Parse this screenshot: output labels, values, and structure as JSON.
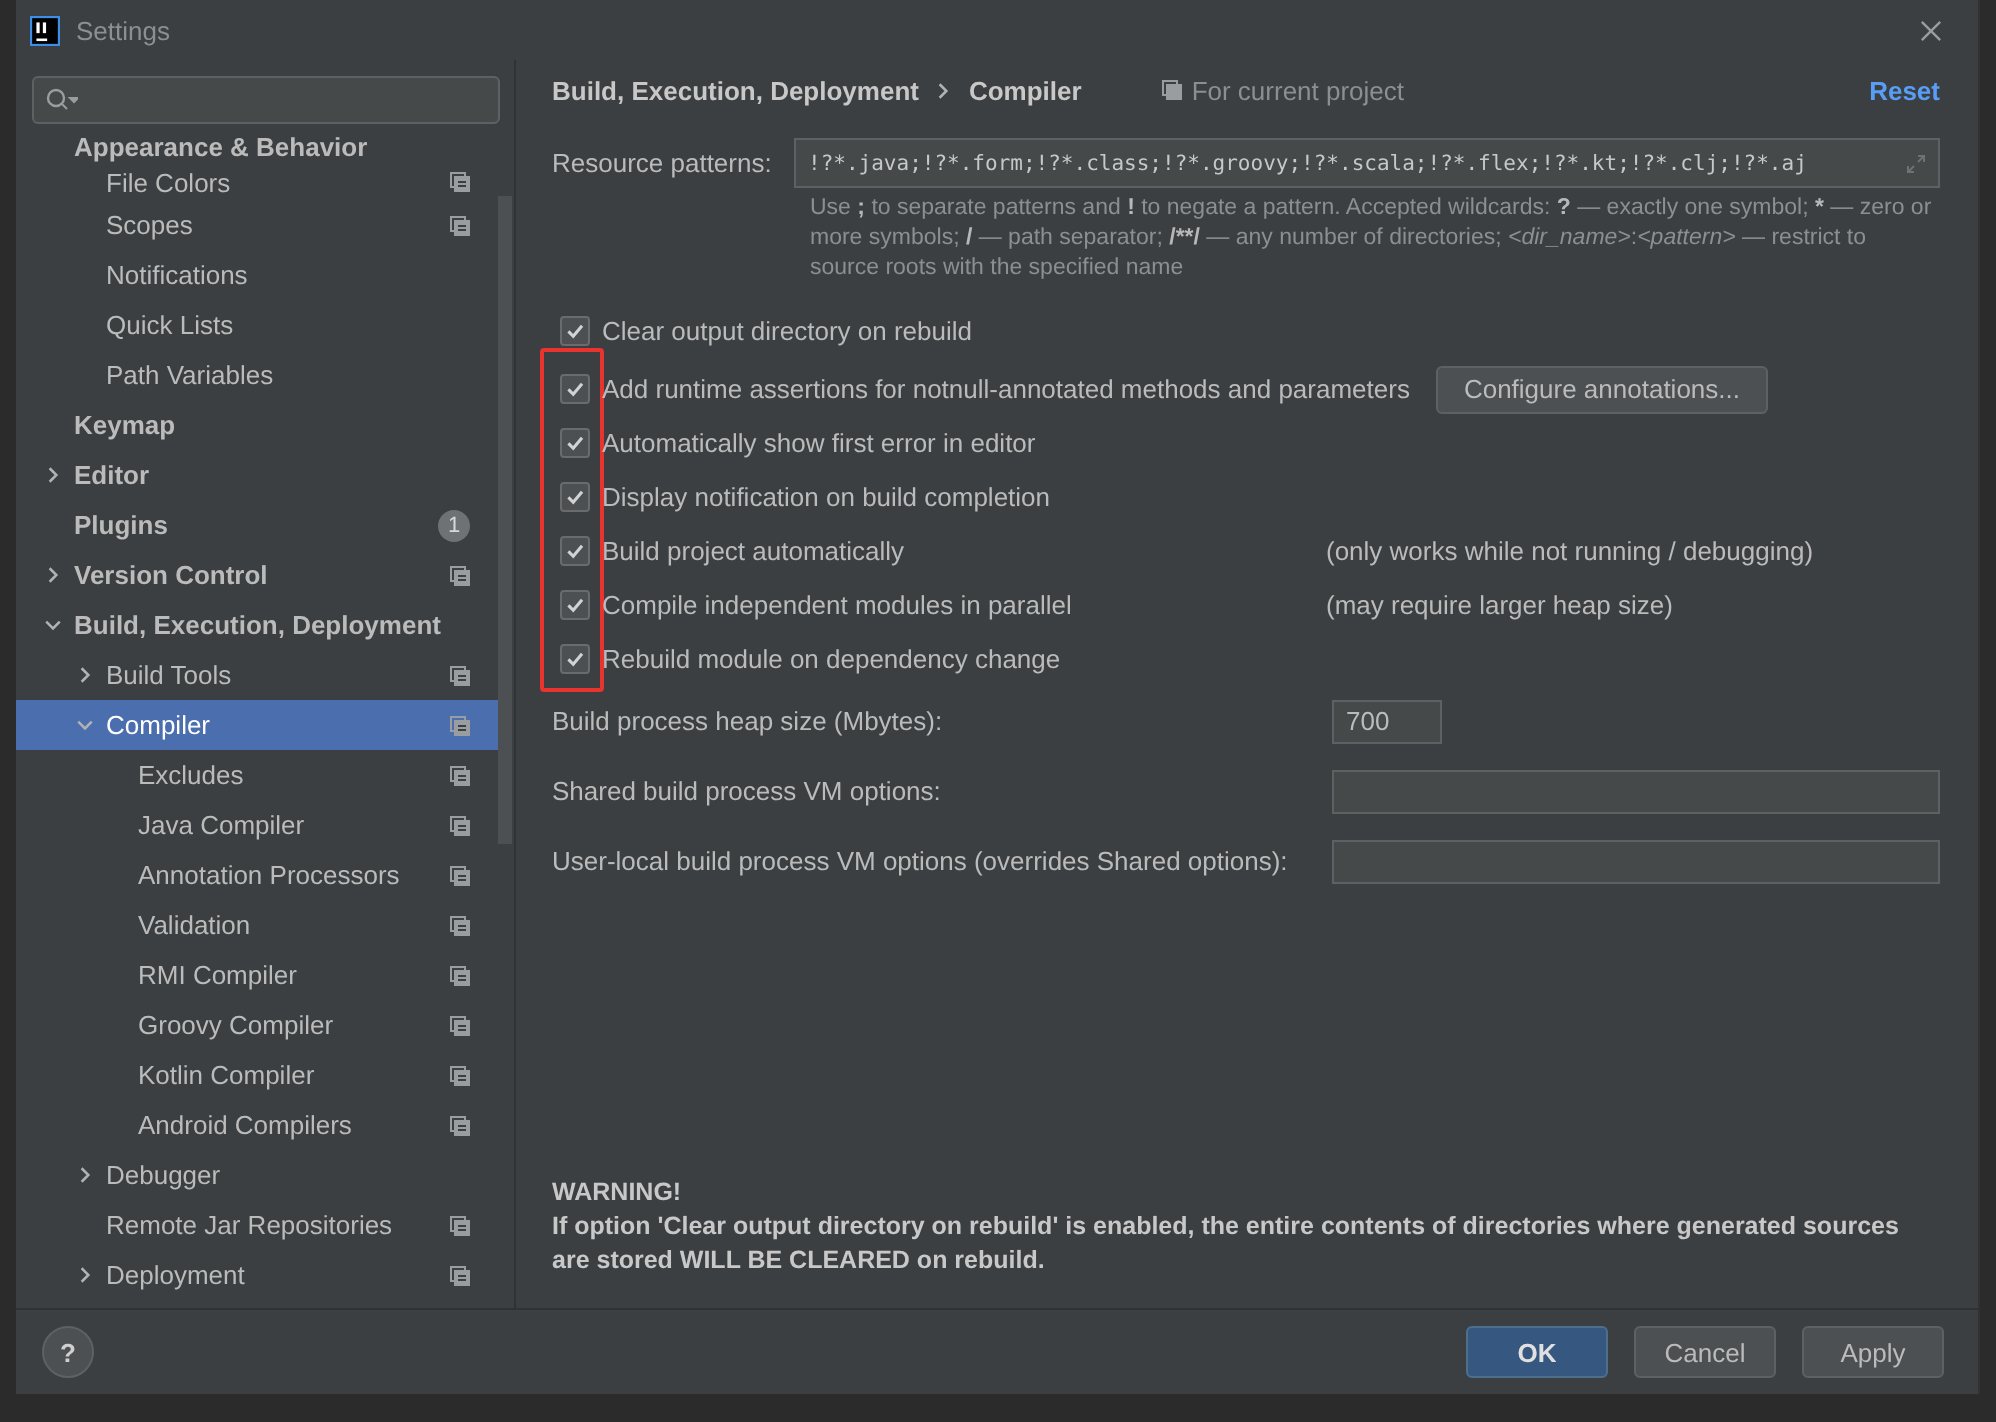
{
  "window": {
    "title": "Settings"
  },
  "sidebar": {
    "tree": [
      {
        "label": "Appearance & Behavior",
        "selected": false,
        "project_level": false,
        "children": [
          {
            "label": "File Colors",
            "selected": false,
            "project_level": true
          },
          {
            "label": "Scopes",
            "selected": false,
            "project_level": true
          },
          {
            "label": "Notifications",
            "selected": false,
            "project_level": false
          },
          {
            "label": "Quick Lists",
            "selected": false,
            "project_level": false
          },
          {
            "label": "Path Variables",
            "selected": false,
            "project_level": false
          }
        ]
      },
      {
        "label": "Keymap",
        "selected": false,
        "project_level": false
      },
      {
        "label": "Editor",
        "selected": false,
        "project_level": false,
        "expanded": false
      },
      {
        "label": "Plugins",
        "selected": false,
        "project_level": false,
        "badge": "1"
      },
      {
        "label": "Version Control",
        "selected": false,
        "project_level": true,
        "expanded": false
      },
      {
        "label": "Build, Execution, Deployment",
        "selected": false,
        "project_level": false,
        "expanded": true,
        "children": [
          {
            "label": "Build Tools",
            "selected": false,
            "project_level": true,
            "expanded": false
          },
          {
            "label": "Compiler",
            "selected": true,
            "project_level": true,
            "expanded": true,
            "children": [
              {
                "label": "Excludes",
                "selected": false,
                "project_level": true
              },
              {
                "label": "Java Compiler",
                "selected": false,
                "project_level": true
              },
              {
                "label": "Annotation Processors",
                "selected": false,
                "project_level": true
              },
              {
                "label": "Validation",
                "selected": false,
                "project_level": true
              },
              {
                "label": "RMI Compiler",
                "selected": false,
                "project_level": true
              },
              {
                "label": "Groovy Compiler",
                "selected": false,
                "project_level": true
              },
              {
                "label": "Kotlin Compiler",
                "selected": false,
                "project_level": true
              },
              {
                "label": "Android Compilers",
                "selected": false,
                "project_level": true
              }
            ]
          },
          {
            "label": "Debugger",
            "selected": false,
            "project_level": false,
            "expanded": false
          },
          {
            "label": "Remote Jar Repositories",
            "selected": false,
            "project_level": true
          },
          {
            "label": "Deployment",
            "selected": false,
            "project_level": true,
            "expanded": false
          }
        ]
      }
    ]
  },
  "breadcrumb": [
    "Build, Execution, Deployment",
    "Compiler"
  ],
  "scope_label": "For current project",
  "reset_link": "Reset",
  "resource_patterns": {
    "label": "Resource patterns:",
    "value": "!?*.java;!?*.form;!?*.class;!?*.groovy;!?*.scala;!?*.flex;!?*.kt;!?*.clj;!?*.aj"
  },
  "hint": [
    {
      "kind": "plain",
      "text": "Use "
    },
    {
      "kind": "bold",
      "text": ";"
    },
    {
      "kind": "plain",
      "text": " to separate patterns and "
    },
    {
      "kind": "bold",
      "text": "!"
    },
    {
      "kind": "plain",
      "text": " to negate a pattern. Accepted wildcards: "
    },
    {
      "kind": "bold",
      "text": "?"
    },
    {
      "kind": "plain",
      "text": " — exactly one symbol; "
    },
    {
      "kind": "bold",
      "text": "*"
    },
    {
      "kind": "plain",
      "text": " — zero or more symbols; "
    },
    {
      "kind": "bold",
      "text": "/"
    },
    {
      "kind": "plain",
      "text": " — path separator; "
    },
    {
      "kind": "bold",
      "text": "/**/"
    },
    {
      "kind": "plain",
      "text": " — any number of directories; "
    },
    {
      "kind": "italic",
      "text": "<dir_name>"
    },
    {
      "kind": "plain",
      "text": ":"
    },
    {
      "kind": "italic",
      "text": "<pattern>"
    },
    {
      "kind": "plain",
      "text": " — restrict to source roots with the specified name"
    }
  ],
  "options": [
    {
      "label": "Clear output directory on rebuild",
      "checked": true
    },
    {
      "label": "Add runtime assertions for notnull-annotated methods and parameters",
      "checked": true,
      "button": "Configure annotations..."
    },
    {
      "label": "Automatically show first error in editor",
      "checked": true
    },
    {
      "label": "Display notification on build completion",
      "checked": true
    },
    {
      "label": "Build project automatically",
      "checked": true,
      "note": "(only works while not running / debugging)"
    },
    {
      "label": "Compile independent modules in parallel",
      "checked": true,
      "note": "(may require larger heap size)"
    },
    {
      "label": "Rebuild module on dependency change",
      "checked": true
    }
  ],
  "fields": [
    {
      "kind": "short",
      "label": "Build process heap size (Mbytes):",
      "value": "700"
    },
    {
      "kind": "wide",
      "label": "Shared build process VM options:"
    },
    {
      "kind": "wide",
      "label": "User-local build process VM options (overrides Shared options):"
    }
  ],
  "warning": {
    "title": "WARNING!",
    "text": "If option 'Clear output directory on rebuild' is enabled, the entire contents of directories where generated sources are stored WILL BE CLEARED on rebuild."
  },
  "help_button": "?",
  "buttons": [
    {
      "label": "OK",
      "kind": "default"
    },
    {
      "label": "Cancel",
      "kind": "normal"
    },
    {
      "label": "Apply",
      "kind": "normal"
    }
  ]
}
